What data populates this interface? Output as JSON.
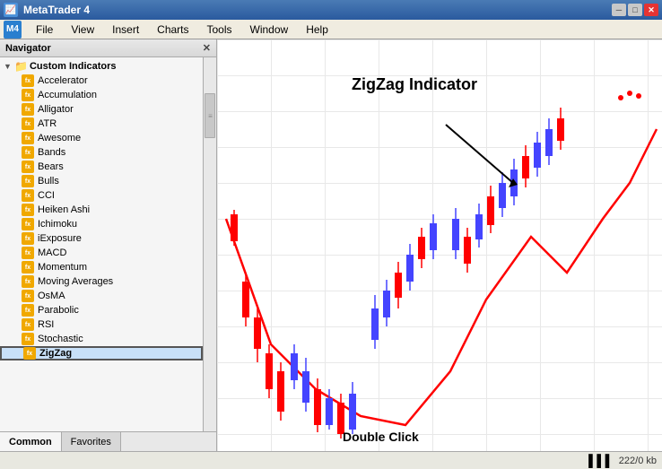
{
  "titleBar": {
    "title": "MetaTrader 4",
    "minimizeLabel": "─",
    "maximizeLabel": "□",
    "closeLabel": "✕"
  },
  "menuBar": {
    "items": [
      "File",
      "View",
      "Insert",
      "Charts",
      "Tools",
      "Window",
      "Help"
    ]
  },
  "navigator": {
    "title": "Navigator",
    "closeLabel": "✕",
    "rootItem": {
      "label": "Custom Indicators",
      "expanded": true
    },
    "indicators": [
      "Accelerator",
      "Accumulation",
      "Alligator",
      "ATR",
      "Awesome",
      "Bands",
      "Bears",
      "Bulls",
      "CCI",
      "Heiken Ashi",
      "Ichimoku",
      "iExposure",
      "MACD",
      "Momentum",
      "Moving Averages",
      "OsMA",
      "Parabolic",
      "RSI",
      "Stochastic",
      "ZigZag"
    ],
    "tabs": [
      "Common",
      "Favorites"
    ]
  },
  "chart": {
    "annotationLabel": "ZigZag Indicator",
    "doubleClickLabel": "Double Click"
  },
  "statusBar": {
    "memoryLabel": "222/0 kb"
  }
}
